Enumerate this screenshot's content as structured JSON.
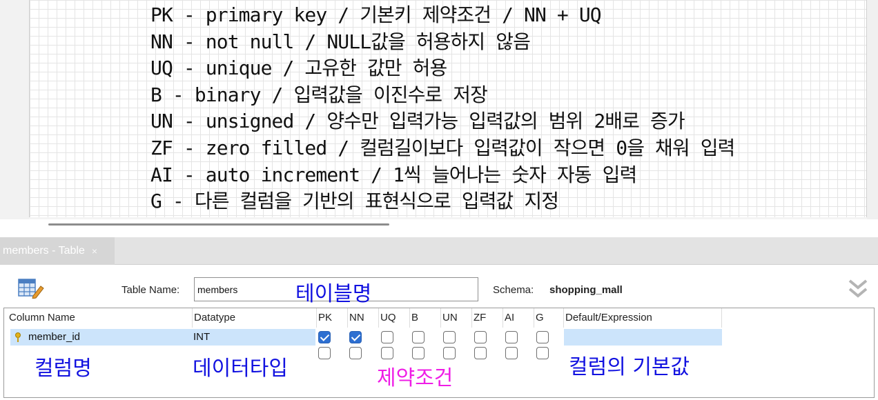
{
  "notes": {
    "lines": [
      "PK - primary key / 기본키 제약조건 / NN + UQ",
      "NN - not null / NULL값을 허용하지 않음",
      "UQ - unique / 고유한 값만 허용",
      "B - binary / 입력값을 이진수로 저장",
      "UN - unsigned / 양수만 입력가능 입력값의 범위 2배로 증가",
      "ZF - zero filled / 컬럼길이보다 입력값이 작으면 0을 채워 입력",
      "AI - auto increment / 1씩 늘어나는 숫자 자동 입력",
      "G - 다른 컬럼을 기반의 표현식으로 입력값 지정"
    ]
  },
  "tab": {
    "label": "members - Table",
    "close": "×"
  },
  "editor": {
    "table_name_label": "Table Name:",
    "table_name_value": "members",
    "schema_label": "Schema:",
    "schema_value": "shopping_mall"
  },
  "columns": {
    "headers": {
      "name": "Column Name",
      "datatype": "Datatype",
      "pk": "PK",
      "nn": "NN",
      "uq": "UQ",
      "b": "B",
      "un": "UN",
      "zf": "ZF",
      "ai": "AI",
      "g": "G",
      "default": "Default/Expression"
    },
    "rows": [
      {
        "name": "member_id",
        "datatype": "INT",
        "flags": {
          "pk": true,
          "nn": true,
          "uq": false,
          "b": false,
          "un": false,
          "zf": false,
          "ai": false,
          "g": false
        },
        "default": ""
      }
    ]
  },
  "annotations": {
    "table_name": "테이블명",
    "column_name": "컬럼명",
    "datatype": "데이터타입",
    "constraints": "제약조건",
    "default": "컬럼의 기본값"
  },
  "colors": {
    "annotation_blue": "#1212e0",
    "annotation_magenta": "#ef1de6",
    "checkbox_on": "#2d6fd1",
    "row_selected": "#cce4fb"
  }
}
